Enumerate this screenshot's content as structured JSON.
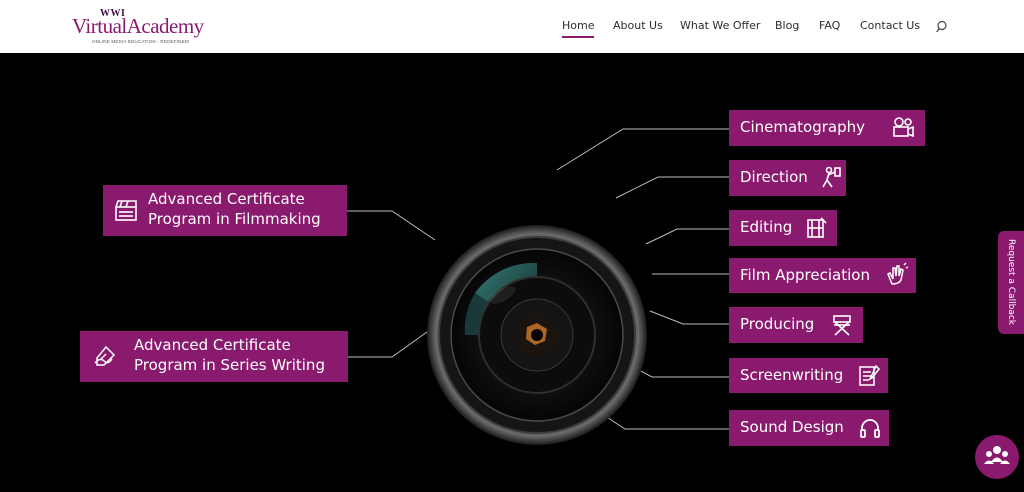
{
  "header": {
    "logo": {
      "top": "WWI",
      "main": "VirtualAcademy",
      "tagline": "ONLINE MEDIA EDUCATION - REDEFINED!"
    },
    "nav": [
      {
        "label": "Home",
        "active": true
      },
      {
        "label": "About Us",
        "active": false
      },
      {
        "label": "What We Offer",
        "active": false
      },
      {
        "label": "Blog",
        "active": false
      },
      {
        "label": "FAQ",
        "active": false
      },
      {
        "label": "Contact Us",
        "active": false
      }
    ],
    "search_icon": "search-icon"
  },
  "programs": [
    {
      "label_line1": "Advanced Certificate",
      "label_line2": "Program in Filmmaking",
      "icon": "clapperboard-icon"
    },
    {
      "label_line1": "Advanced Certificate",
      "label_line2": "Program in Series Writing",
      "icon": "writing-hand-icon"
    }
  ],
  "courses": [
    {
      "label": "Cinematography",
      "icon": "movie-camera-icon"
    },
    {
      "label": "Direction",
      "icon": "director-icon"
    },
    {
      "label": "Editing",
      "icon": "film-strip-icon"
    },
    {
      "label": "Film Appreciation",
      "icon": "clapping-hands-icon"
    },
    {
      "label": "Producing",
      "icon": "director-chair-icon"
    },
    {
      "label": "Screenwriting",
      "icon": "script-icon"
    },
    {
      "label": "Sound Design",
      "icon": "headphones-icon"
    }
  ],
  "callback": {
    "label": "Request a Callback"
  },
  "chat_icon": "chat-people-icon",
  "colors": {
    "brand": "#8a1a6e",
    "background": "#000000",
    "text_light": "#ffffff"
  }
}
